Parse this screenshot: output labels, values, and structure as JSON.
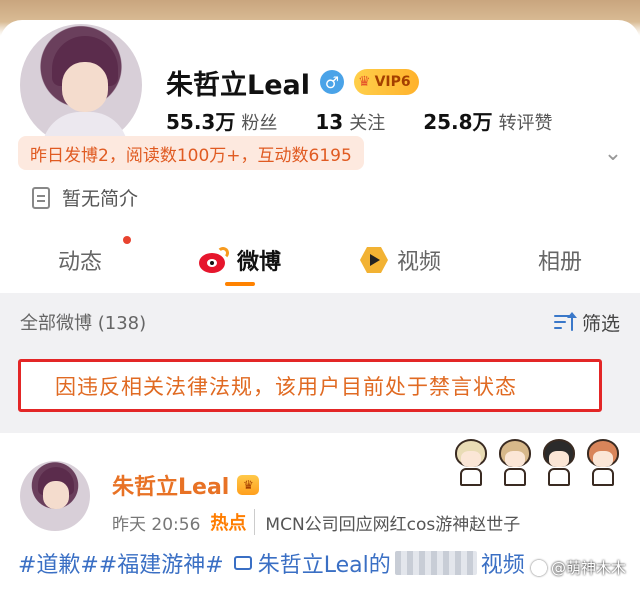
{
  "profile": {
    "name": "朱哲立Leal",
    "gender_icon": "male-symbol-icon",
    "gender_symbol": "♂",
    "vip_label": "VIP6",
    "stats": [
      {
        "value": "55.3万",
        "label": "粉丝"
      },
      {
        "value": "13",
        "label": "关注"
      },
      {
        "value": "25.8万",
        "label": "转评赞"
      }
    ],
    "highlight": "昨日发博2，阅读数100万+，互动数6195",
    "bio": "暂无简介"
  },
  "tabs": [
    {
      "label": "动态",
      "has_dot": true
    },
    {
      "label": "微博",
      "active": true
    },
    {
      "label": "视频"
    },
    {
      "label": "相册"
    }
  ],
  "feed": {
    "title": "全部微博 (138)",
    "filter_label": "筛选"
  },
  "ban_notice": "因违反相关法律法规，该用户目前处于禁言状态",
  "post": {
    "author": "朱哲立Leal",
    "time": "昨天 20:56",
    "hot_label": "热点",
    "hot_text": "MCN公司回应网红cos游神赵世子",
    "text_tags": "#道歉##福建游神#",
    "text_link": "朱哲立Leal的",
    "text_tail": "视频"
  },
  "watermark": "@萌神木木",
  "colors": {
    "accent_orange": "#ff8200",
    "ban_border": "#e32626",
    "link_blue": "#3a6fc4"
  }
}
